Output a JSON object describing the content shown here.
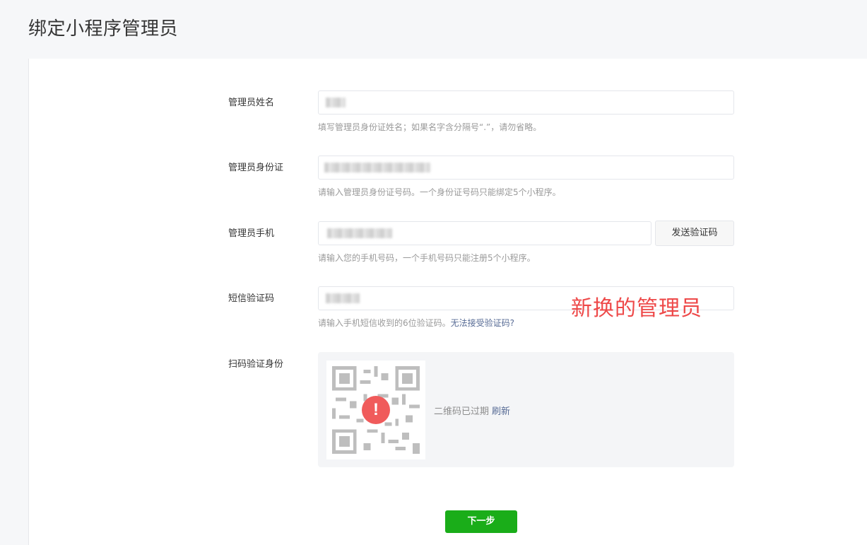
{
  "page": {
    "title": "绑定小程序管理员"
  },
  "form": {
    "name": {
      "label": "管理员姓名",
      "hint": "填写管理员身份证姓名；如果名字含分隔号“.”，请勿省略。"
    },
    "id_card": {
      "label": "管理员身份证",
      "hint": "请输入管理员身份证号码。一个身份证号码只能绑定5个小程序。"
    },
    "phone": {
      "label": "管理员手机",
      "send_code_label": "发送验证码",
      "hint": "请输入您的手机号码，一个手机号码只能注册5个小程序。"
    },
    "sms_code": {
      "label": "短信验证码",
      "hint": "请输入手机短信收到的6位验证码。",
      "help_link": "无法接受验证码?"
    },
    "qr_verify": {
      "label": "扫码验证身份",
      "status_text": "二维码已过期",
      "refresh_link": "刷新"
    },
    "next_label": "下一步"
  },
  "annotation": {
    "text": "新换的管理员",
    "color": "#ee4949"
  },
  "colors": {
    "primary_button": "#1aad19",
    "link": "#576b95",
    "alert": "#f05b5b"
  },
  "icons": {
    "qr_alert": "exclamation-circle-icon"
  }
}
